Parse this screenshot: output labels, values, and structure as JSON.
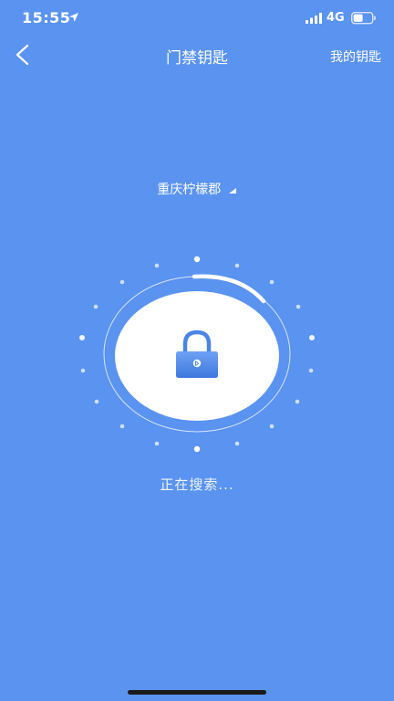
{
  "status_bar": {
    "time": "15:55",
    "network": "4G"
  },
  "nav": {
    "title": "门禁钥匙",
    "right_action": "我的钥匙",
    "back_icon": "chevron-left-icon"
  },
  "community": {
    "name": "重庆柠檬郡",
    "icon": "caret-down-icon"
  },
  "search": {
    "status": "正在搜索..."
  },
  "colors": {
    "background": "#5a93f0",
    "lock_body": "#4b84e6",
    "ring": "#ffffff"
  }
}
